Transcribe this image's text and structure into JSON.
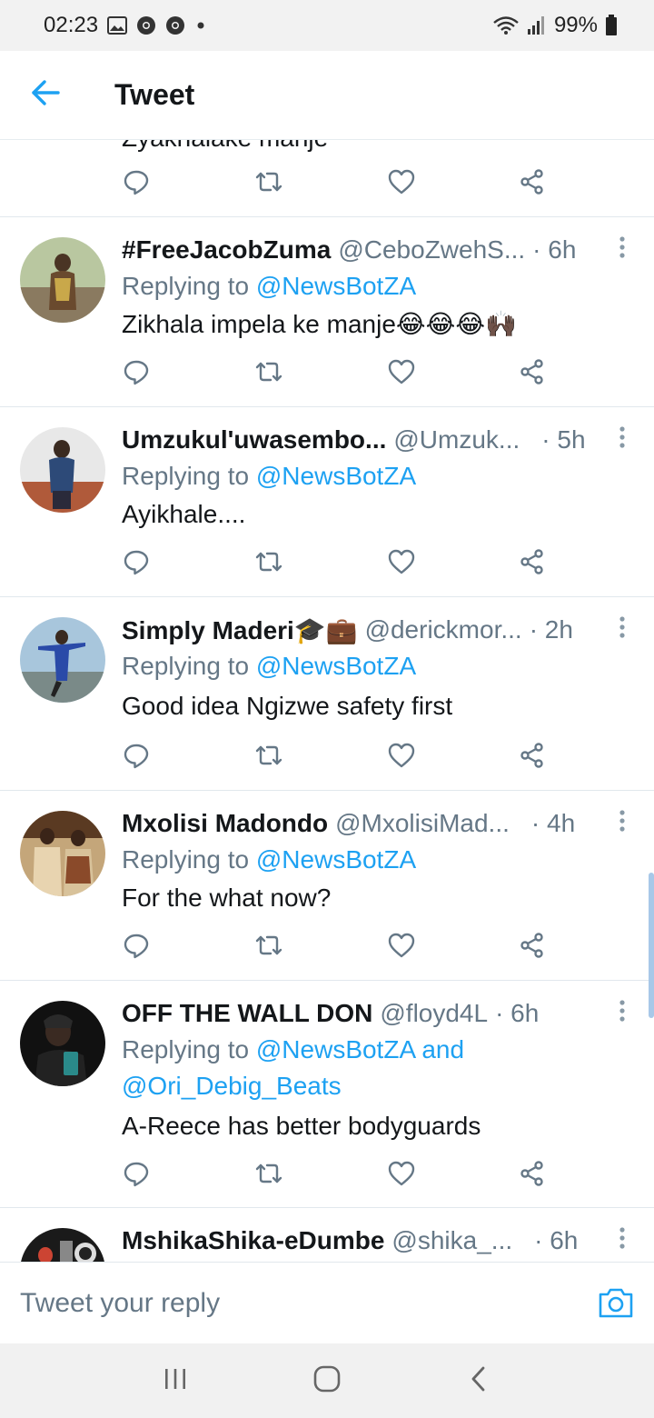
{
  "status_bar": {
    "time": "02:23",
    "left_icons": [
      "image-icon",
      "chrome-icon",
      "chrome-icon",
      "dot-icon"
    ],
    "battery": "99%",
    "right_icons": [
      "wifi-icon",
      "signal-icon",
      "battery-icon"
    ]
  },
  "header": {
    "title": "Tweet",
    "back_icon": "arrow-left-icon"
  },
  "feed": {
    "partial_text": "Zyakhalake manje",
    "tweets": [
      {
        "name": "#FreeJacobZuma",
        "handle": "@CeboZwehS...",
        "time": "· 6h",
        "replying_prefix": "Replying to",
        "mentions": [
          "@NewsBotZA"
        ],
        "text": "Zikhala impela ke manje😂😂😂🙌🏿",
        "avatar_color": "#8a7a60"
      },
      {
        "name": "Umzukul'uwasembo...",
        "handle": "@Umzuk...",
        "time": "· 5h",
        "replying_prefix": "Replying to",
        "mentions": [
          "@NewsBotZA"
        ],
        "text": "Ayikhale....",
        "avatar_color": "#c8c8c8"
      },
      {
        "name": "Simply Maderi🎓💼",
        "handle": "@derickmor...",
        "time": "· 2h",
        "replying_prefix": "Replying to",
        "mentions": [
          "@NewsBotZA"
        ],
        "text": "Good idea Ngizwe safety first",
        "avatar_color": "#7aa3c2"
      },
      {
        "name": "Mxolisi Madondo",
        "handle": "@MxolisiMad...",
        "time": "· 4h",
        "replying_prefix": "Replying to",
        "mentions": [
          "@NewsBotZA"
        ],
        "text": "For the what now?",
        "avatar_color": "#6b4a2f"
      },
      {
        "name": "OFF THE WALL DON",
        "handle": "@floyd4L",
        "time": "· 6h",
        "replying_prefix": "Replying to",
        "mentions": [
          "@NewsBotZA",
          "@Ori_Debig_Beats"
        ],
        "mention_joiner": "and",
        "text": "A-Reece has better bodyguards",
        "avatar_color": "#1a1a1a"
      },
      {
        "name": "MshikaShika-eDumbe",
        "handle": "@shika_...",
        "time": "· 6h",
        "avatar_color": "#2a2a2a"
      }
    ]
  },
  "reply_bar": {
    "placeholder": "Tweet your reply",
    "camera_icon": "camera-icon"
  },
  "nav_bar": {
    "buttons": [
      "recent-apps-icon",
      "home-icon",
      "back-icon"
    ]
  },
  "colors": {
    "accent": "#1da1f2",
    "muted": "#657786",
    "text": "#14171a",
    "divider": "#e1e8ed"
  }
}
